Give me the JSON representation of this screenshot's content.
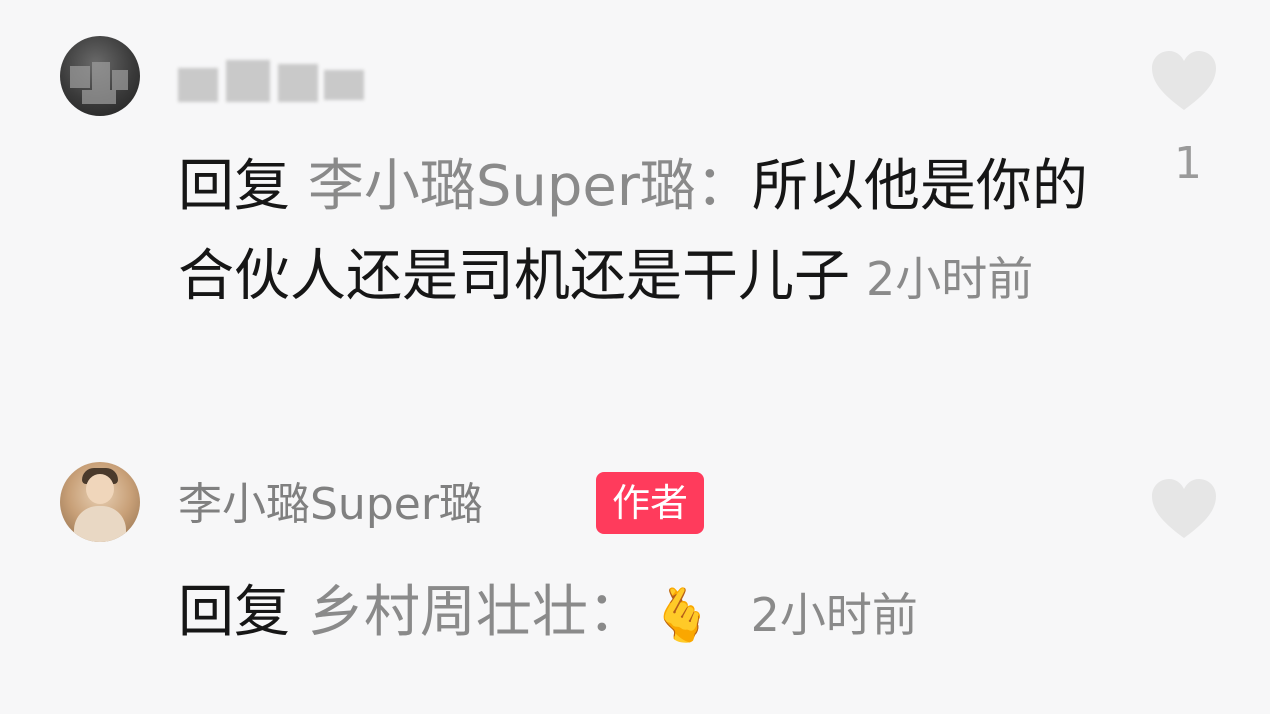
{
  "comments": [
    {
      "avatar_icon": "blurred-user-avatar",
      "username_obscured": true,
      "reply_prefix": "回复",
      "reply_target": "李小璐Super璐",
      "separator": "：",
      "content": "所以他是你的合伙人还是司机还是干儿子",
      "timestamp": "2小时前",
      "like_icon": "heart-icon",
      "like_count": "1"
    },
    {
      "avatar_icon": "user-avatar",
      "username": "李小璐Super璐",
      "badge": "作者",
      "badge_color": "#ff3b5c",
      "reply_prefix": "回复",
      "reply_target": "乡村周壮壮",
      "separator": "：",
      "emoji": "🫰",
      "emoji_name": "finger-heart-emoji",
      "timestamp": "2小时前",
      "like_icon": "heart-icon"
    }
  ]
}
